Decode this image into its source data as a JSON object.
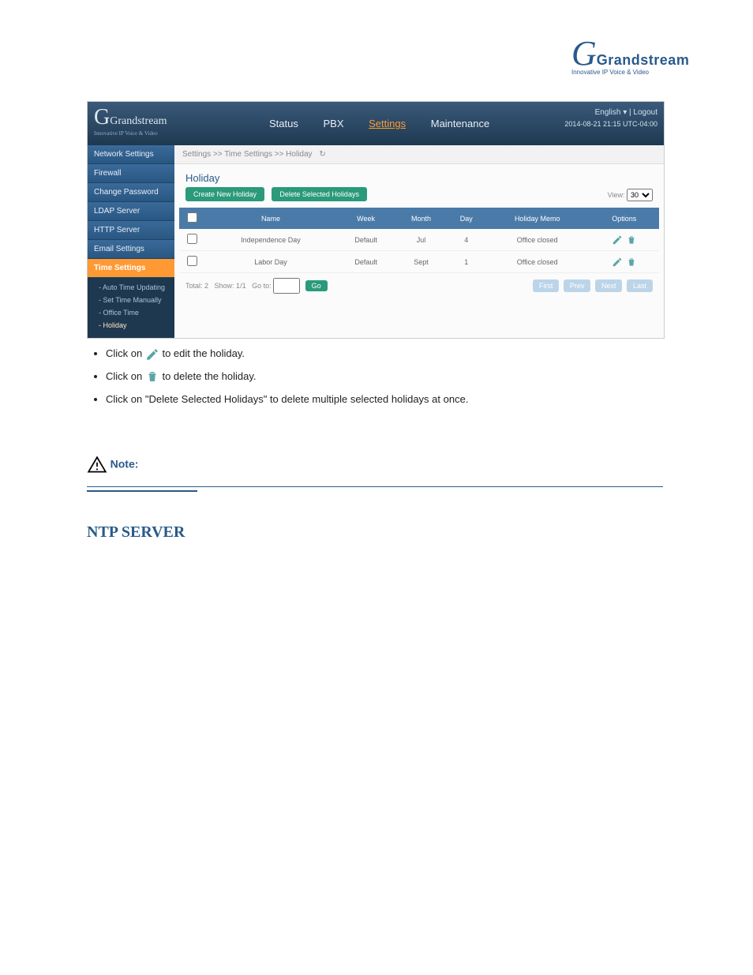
{
  "brand": {
    "name": "Grandstream",
    "tagline": "Innovative IP Voice & Video"
  },
  "topbar": {
    "nav": [
      "Status",
      "PBX",
      "Settings",
      "Maintenance"
    ],
    "active": "Settings",
    "lang": "English",
    "logout": "Logout",
    "datetime": "2014-08-21 21:15 UTC-04:00"
  },
  "sidebar": {
    "items": [
      "Network Settings",
      "Firewall",
      "Change Password",
      "LDAP Server",
      "HTTP Server",
      "Email Settings",
      "Time Settings"
    ],
    "sub": [
      "Auto Time Updating",
      "Set Time Manually",
      "Office Time",
      "Holiday"
    ],
    "sub_current": "Holiday"
  },
  "breadcrumb": "Settings >> Time Settings >> Holiday",
  "section_title": "Holiday",
  "buttons": {
    "create": "Create New Holiday",
    "delete_sel": "Delete Selected Holidays",
    "go": "Go"
  },
  "view": {
    "label": "View:",
    "value": "30"
  },
  "table": {
    "headers": [
      "",
      "Name",
      "Week",
      "Month",
      "Day",
      "Holiday Memo",
      "Options"
    ],
    "rows": [
      {
        "name": "Independence Day",
        "week": "Default",
        "month": "Jul",
        "day": "4",
        "memo": "Office closed"
      },
      {
        "name": "Labor Day",
        "week": "Default",
        "month": "Sept",
        "day": "1",
        "memo": "Office closed"
      }
    ]
  },
  "pager": {
    "summary_total": "Total: 2",
    "summary_show": "Show: 1/1",
    "goto_label": "Go to:",
    "buttons": [
      "First",
      "Prev",
      "Next",
      "Last"
    ]
  },
  "doc": {
    "bullets": [
      {
        "prefix": "Click on ",
        "icon": "edit",
        "suffix": " to edit the holiday."
      },
      {
        "prefix": "Click on ",
        "icon": "trash",
        "suffix": " to delete the holiday."
      },
      {
        "prefix": "Click on \"Delete Selected Holidays\" to delete multiple selected holidays at once.",
        "icon": null,
        "suffix": ""
      }
    ],
    "note_label": "Note:",
    "heading": "NTP SERVER"
  }
}
